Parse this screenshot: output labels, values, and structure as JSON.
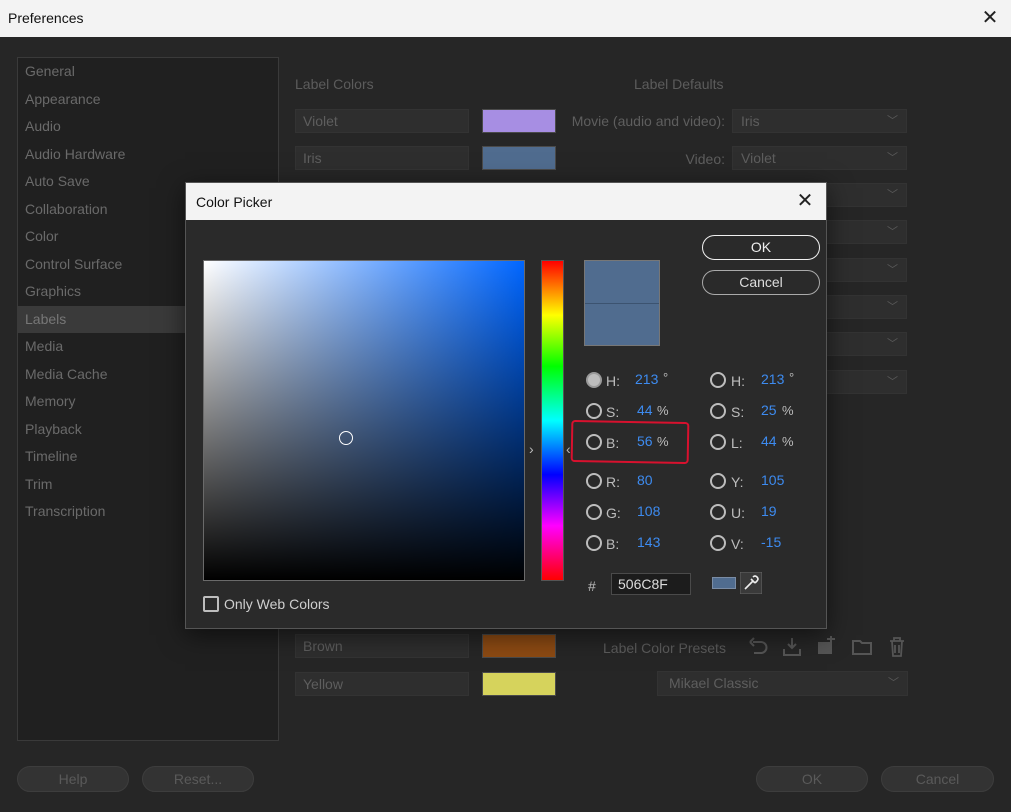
{
  "window": {
    "title": "Preferences"
  },
  "sidebar": {
    "items": [
      {
        "label": "General"
      },
      {
        "label": "Appearance"
      },
      {
        "label": "Audio"
      },
      {
        "label": "Audio Hardware"
      },
      {
        "label": "Auto Save"
      },
      {
        "label": "Collaboration"
      },
      {
        "label": "Color"
      },
      {
        "label": "Control Surface"
      },
      {
        "label": "Graphics"
      },
      {
        "label": "Labels",
        "selected": true
      },
      {
        "label": "Media"
      },
      {
        "label": "Media Cache"
      },
      {
        "label": "Memory"
      },
      {
        "label": "Playback"
      },
      {
        "label": "Timeline"
      },
      {
        "label": "Trim"
      },
      {
        "label": "Transcription"
      }
    ]
  },
  "labels": {
    "colors_heading": "Label Colors",
    "defaults_heading": "Label Defaults",
    "colors": [
      {
        "name": "Violet",
        "color": "#a78ee3"
      },
      {
        "name": "Iris",
        "color": "#506c8f"
      },
      {
        "name": "Brown",
        "color": "#8c4a13"
      },
      {
        "name": "Yellow",
        "color": "#d6d35c"
      }
    ],
    "defaults": [
      {
        "label": "Movie (audio and video):",
        "value": "Iris"
      },
      {
        "label": "Video:",
        "value": "Violet"
      }
    ],
    "presets_label": "Label Color Presets",
    "preset_value": "Mikael Classic"
  },
  "footer": {
    "help": "Help",
    "reset": "Reset...",
    "ok": "OK",
    "cancel": "Cancel"
  },
  "color_picker": {
    "title": "Color Picker",
    "ok": "OK",
    "cancel": "Cancel",
    "only_web_colors": "Only Web Colors",
    "hex_prefix": "#",
    "hex": "506C8F",
    "current_color": "#506c8f",
    "selected_mode": "H",
    "hsb": {
      "h": {
        "label": "H:",
        "value": "213",
        "unit": "°"
      },
      "s": {
        "label": "S:",
        "value": "44",
        "unit": "%"
      },
      "b": {
        "label": "B:",
        "value": "56",
        "unit": "%"
      }
    },
    "hsl": {
      "h": {
        "label": "H:",
        "value": "213",
        "unit": "°"
      },
      "s": {
        "label": "S:",
        "value": "25",
        "unit": "%"
      },
      "l": {
        "label": "L:",
        "value": "44",
        "unit": "%"
      }
    },
    "rgb": {
      "r": {
        "label": "R:",
        "value": "80"
      },
      "g": {
        "label": "G:",
        "value": "108"
      },
      "b": {
        "label": "B:",
        "value": "143"
      }
    },
    "yuv": {
      "y": {
        "label": "Y:",
        "value": "105"
      },
      "u": {
        "label": "U:",
        "value": "19"
      },
      "v": {
        "label": "V:",
        "value": "-15"
      }
    }
  }
}
